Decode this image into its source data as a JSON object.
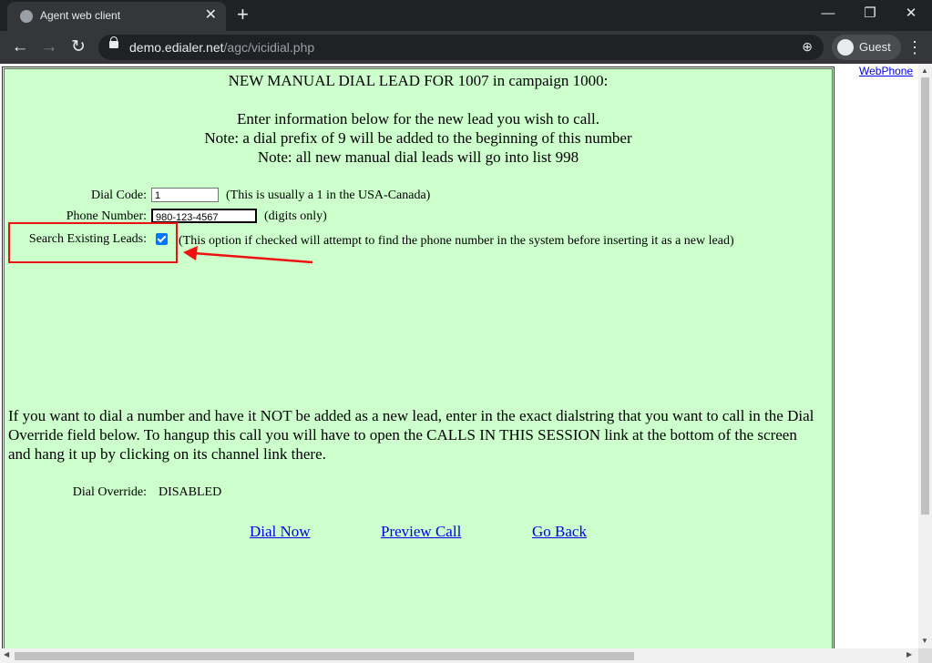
{
  "browser": {
    "tab_title": "Agent web client",
    "tab_close": "✕",
    "new_tab": "+",
    "url_host": "demo.edialer.net",
    "url_path": "/agc/vicidial.php",
    "profile_name": "Guest",
    "window_minimize": "—",
    "window_restore": "❐",
    "window_close": "✕",
    "back": "←",
    "forward": "→",
    "reload": "↻",
    "menu": "⋮",
    "zoom": "⊕"
  },
  "page": {
    "heading": "NEW MANUAL DIAL LEAD FOR 1007 in campaign 1000:",
    "info_line1": "Enter information below for the new lead you wish to call.",
    "info_line2": "Note: a dial prefix of 9 will be added to the beginning of this number",
    "info_line3": "Note: all new manual dial leads will go into list 998",
    "dial_code_label": "Dial Code:",
    "dial_code_value": "1",
    "dial_code_hint": "(This is usually a 1 in the USA-Canada)",
    "phone_label": "Phone Number:",
    "phone_value": "980-123-4567",
    "phone_hint": "(digits only)",
    "search_label": "Search Existing Leads:",
    "search_checked": true,
    "search_hint": "(This option if checked will attempt to find the phone number in the system before inserting it as a new lead)",
    "override_text": "If you want to dial a number and have it NOT be added as a new lead, enter in the exact dialstring that you want to call in the Dial Override field below. To hangup this call you will have to open the CALLS IN THIS SESSION link at the bottom of the screen and hang it up by clicking on its channel link there.",
    "override_label": "Dial Override:",
    "override_value": "DISABLED",
    "links": {
      "dial_now": "Dial Now",
      "preview_call": "Preview Call",
      "go_back": "Go Back"
    },
    "webphone_link": "WebPhone",
    "annotation_color": "#ee1111"
  }
}
